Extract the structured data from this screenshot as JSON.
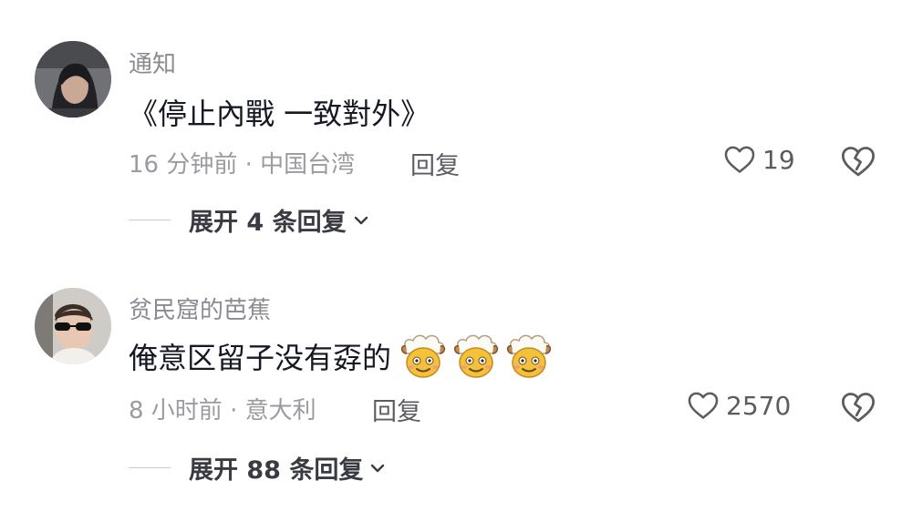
{
  "comments": [
    {
      "username": "通知",
      "text": "《停止內戰 一致對外》",
      "time_location": "16 分钟前 · 中国台湾",
      "reply_label": "回复",
      "like_count": "19",
      "expand_label": "展开 4 条回复"
    },
    {
      "username": "贫民窟的芭蕉",
      "text": "俺意区留子没有孬的",
      "emojis": [
        "sheep-emoji",
        "sheep-emoji",
        "sheep-emoji"
      ],
      "time_location": "8 小时前 · 意大利",
      "reply_label": "回复",
      "like_count": "2570",
      "expand_label": "展开 88 条回复"
    }
  ],
  "colors": {
    "username": "#8a8b91",
    "text": "#161823",
    "meta": "#9a9ba0",
    "action": "#5b5c62"
  }
}
